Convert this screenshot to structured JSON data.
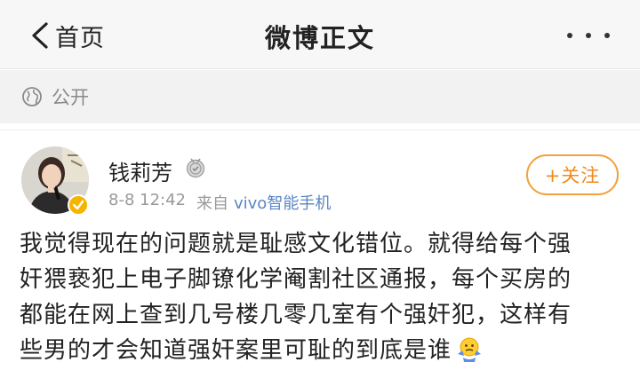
{
  "header": {
    "back_label": "首页",
    "title": "微博正文",
    "back_icon": "chevron-left-icon",
    "more_icon": "more-dots-icon"
  },
  "visibility": {
    "icon": "globe-icon",
    "label": "公开"
  },
  "post": {
    "author": "钱莉芳",
    "badge_icon": "medal-icon",
    "verified_icon": "verified-badge-icon",
    "time": "8-8 12:42",
    "source_prefix": "来自",
    "device": "vivo智能手机",
    "follow_label": "+关注",
    "content_lines": [
      "我觉得现在的问题就是耻感文化错位。就得给每个强",
      "奸猥亵犯上电子脚镣化学阉割社区通报，每个买房的",
      "都能在网上查到几号楼几零几室有个强奸犯，这样有",
      "些男的才会知道强奸案里可耻的到底是谁"
    ],
    "emoji_icon": "shrug-emoji-icon"
  },
  "colors": {
    "accent": "#f08a1d",
    "link": "#5a86c4",
    "verified": "#f4b400"
  }
}
